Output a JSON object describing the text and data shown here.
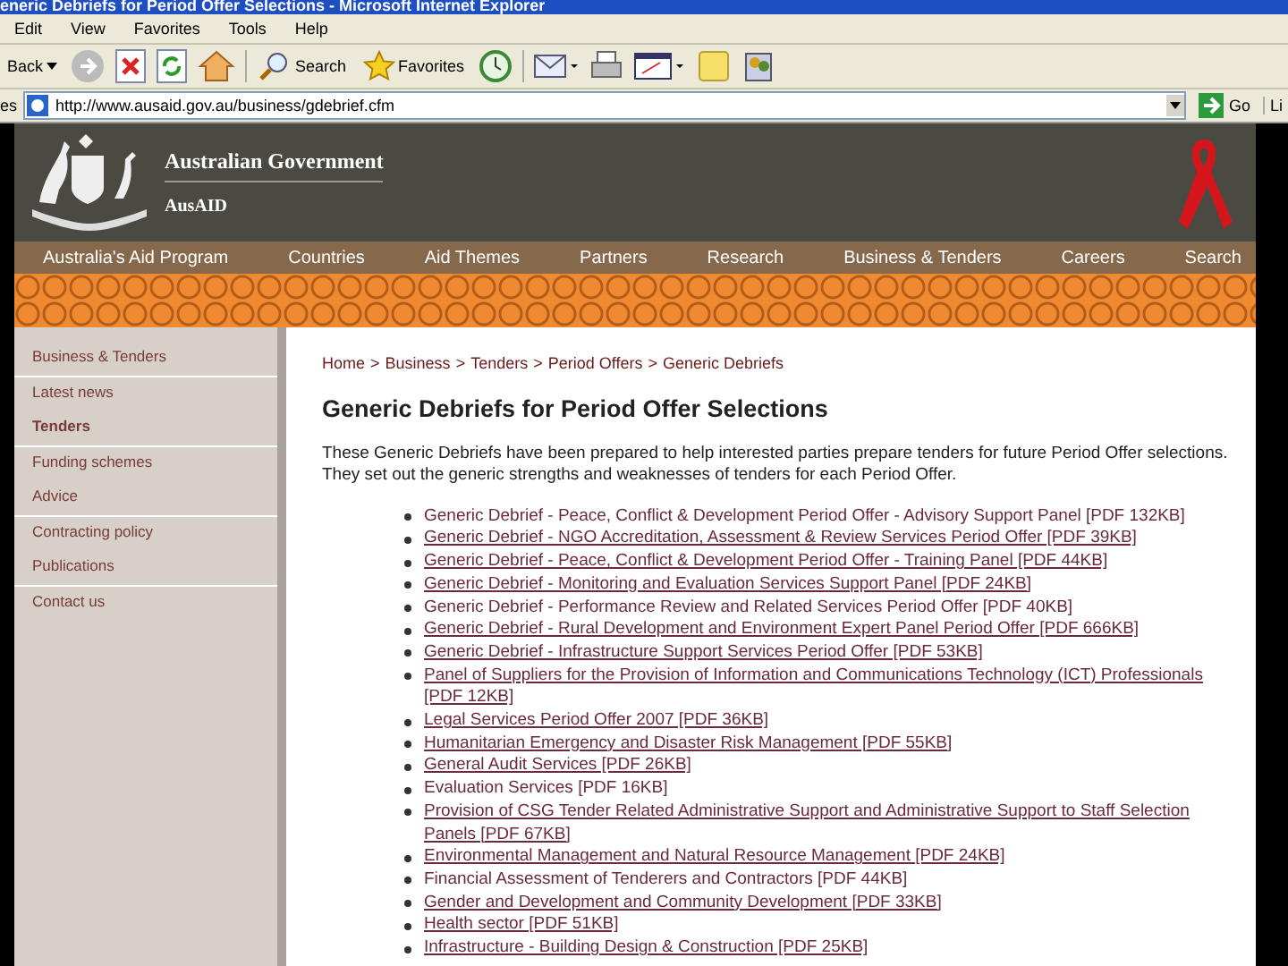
{
  "window": {
    "title": "eneric Debriefs for Period Offer Selections - Microsoft Internet Explorer"
  },
  "menu_bar": [
    "Edit",
    "View",
    "Favorites",
    "Tools",
    "Help"
  ],
  "toolbar": {
    "back": "Back",
    "search": "Search",
    "favorites": "Favorites"
  },
  "address_bar": {
    "label": "es",
    "url": "http://www.ausaid.gov.au/business/gdebrief.cfm",
    "go": "Go",
    "links": "Li"
  },
  "header": {
    "government": "Australian Government",
    "agency": "AusAID"
  },
  "nav": [
    "Australia's Aid Program",
    "Countries",
    "Aid Themes",
    "Partners",
    "Research",
    "Business & Tenders",
    "Careers",
    "Search"
  ],
  "sidebar": {
    "items": [
      {
        "label": "Business & Tenders",
        "selected": false,
        "divider_after": true
      },
      {
        "label": "Latest news",
        "selected": false,
        "divider_after": false
      },
      {
        "label": "Tenders",
        "selected": true,
        "divider_after": true
      },
      {
        "label": "Funding schemes",
        "selected": false,
        "divider_after": false
      },
      {
        "label": "Advice",
        "selected": false,
        "divider_after": true
      },
      {
        "label": "Contracting policy",
        "selected": false,
        "divider_after": false
      },
      {
        "label": "Publications",
        "selected": false,
        "divider_after": true
      },
      {
        "label": "Contact us",
        "selected": false,
        "divider_after": false
      }
    ]
  },
  "breadcrumb": {
    "separator": ">",
    "items": [
      "Home",
      "Business",
      "Tenders",
      "Period Offers",
      "Generic Debriefs"
    ]
  },
  "heading": "Generic Debriefs for Period Offer Selections",
  "intro": "These Generic Debriefs have been prepared to help interested parties prepare tenders for future Period Offer selections. They set out the generic strengths and weaknesses of tenders for each Period Offer.",
  "documents": [
    {
      "label": "Generic Debrief - Peace, Conflict & Development Period Offer - Advisory Support Panel [PDF 132KB]",
      "underlined": false
    },
    {
      "label": "Generic Debrief - NGO Accreditation, Assessment & Review Services Period Offer [PDF 39KB]",
      "underlined": true
    },
    {
      "label": "Generic Debrief - Peace, Conflict & Development Period Offer - Training Panel [PDF 44KB]",
      "underlined": true
    },
    {
      "label": "Generic Debrief - Monitoring and Evaluation Services Support Panel [PDF 24KB]",
      "underlined": true
    },
    {
      "label": "Generic Debrief - Performance Review and Related Services Period Offer [PDF 40KB]",
      "underlined": false
    },
    {
      "label": "Generic Debrief - Rural Development and Environment Expert Panel Period Offer [PDF 666KB]",
      "underlined": true
    },
    {
      "label": "Generic Debrief - Infrastructure Support Services Period Offer [PDF 53KB]",
      "underlined": true
    },
    {
      "label": "Panel of Suppliers for the Provision of Information and Communications Technology (ICT) Professionals [PDF 12KB]",
      "underlined": true
    },
    {
      "label": "Legal Services Period Offer 2007 [PDF 36KB]",
      "underlined": true
    },
    {
      "label": "Humanitarian Emergency and Disaster Risk Management [PDF 55KB]",
      "underlined": true
    },
    {
      "label": "General Audit Services [PDF 26KB]",
      "underlined": true
    },
    {
      "label": "Evaluation Services [PDF 16KB]",
      "underlined": false
    },
    {
      "label": "Provision of CSG Tender Related Administrative Support and Administrative Support to Staff Selection Panels [PDF 67KB]",
      "underlined": true
    },
    {
      "label": "Environmental Management and Natural Resource Management [PDF 24KB]",
      "underlined": true
    },
    {
      "label": "Financial Assessment of Tenderers and Contractors [PDF 44KB]",
      "underlined": false
    },
    {
      "label": "Gender and Development and Community Development [PDF 33KB]",
      "underlined": true
    },
    {
      "label": "Health sector [PDF 51KB]",
      "underlined": true
    },
    {
      "label": "Infrastructure - Building Design & Construction [PDF 25KB]",
      "underlined": true
    }
  ]
}
